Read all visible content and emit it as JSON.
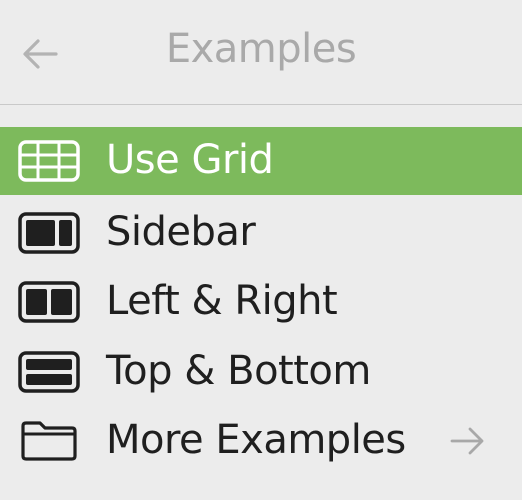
{
  "header": {
    "title": "Examples",
    "back_icon": "arrow-left-icon"
  },
  "menu": {
    "items": [
      {
        "label": "Use Grid",
        "icon": "grid-icon",
        "selected": true
      },
      {
        "label": "Sidebar",
        "icon": "sidebar-layout-icon",
        "selected": false
      },
      {
        "label": "Left & Right",
        "icon": "left-right-layout-icon",
        "selected": false
      },
      {
        "label": "Top & Bottom",
        "icon": "top-bottom-layout-icon",
        "selected": false
      },
      {
        "label": "More Examples",
        "icon": "folder-icon",
        "selected": false,
        "submenu_icon": "arrow-right-icon"
      }
    ]
  },
  "colors": {
    "selected_background": "#7dba5c",
    "menu_background": "#ececec",
    "header_text": "#a9a9a9",
    "item_text": "#1f1f1f"
  }
}
